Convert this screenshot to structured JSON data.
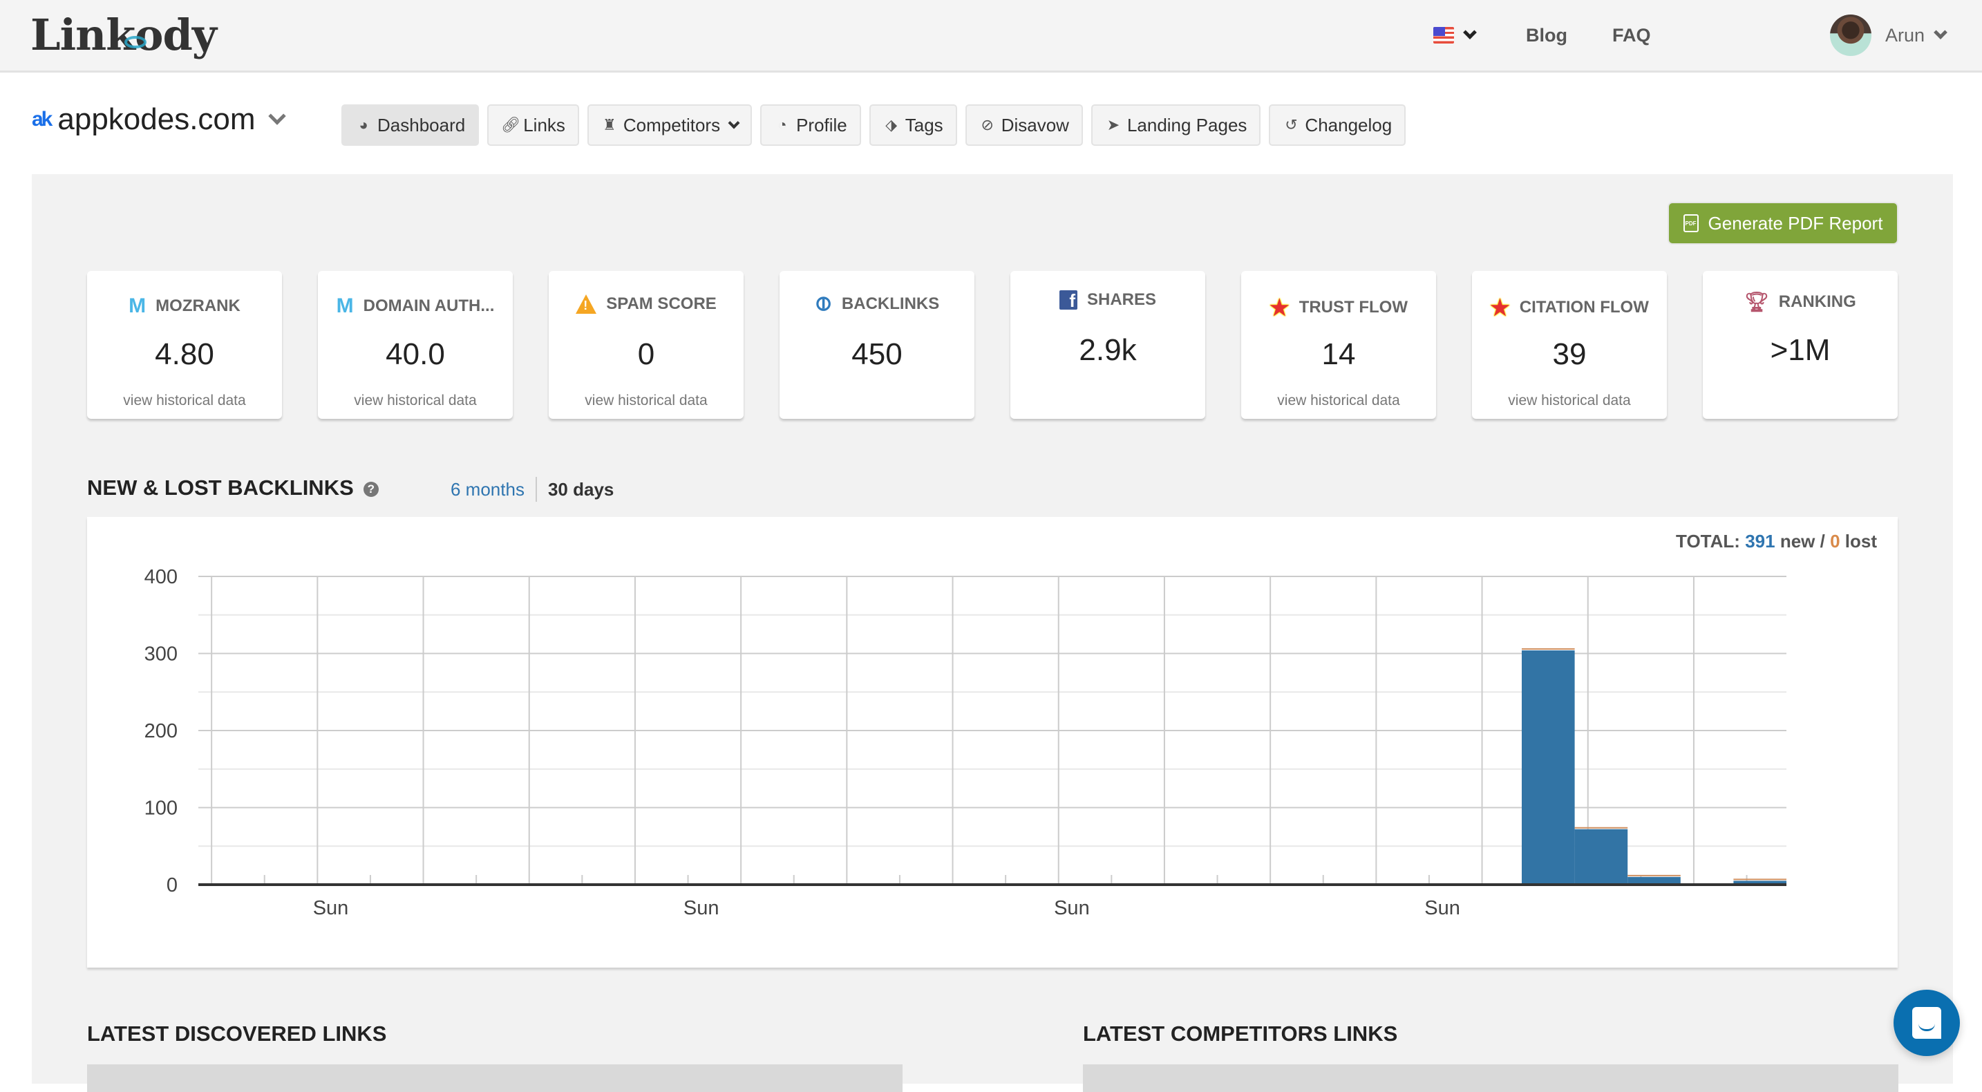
{
  "header": {
    "logo": "Linkody",
    "language_icon": "us-flag-icon",
    "links": [
      "Blog",
      "FAQ"
    ],
    "user_name": "Arun"
  },
  "site": {
    "domain": "appkodes.com",
    "domain_logo": "ak"
  },
  "nav": [
    {
      "label": "Dashboard",
      "icon": "dashboard-icon",
      "active": true
    },
    {
      "label": "Links",
      "icon": "link-icon"
    },
    {
      "label": "Competitors",
      "icon": "rook-icon",
      "dropdown": true
    },
    {
      "label": "Profile",
      "icon": "pie-chart-icon"
    },
    {
      "label": "Tags",
      "icon": "tag-icon"
    },
    {
      "label": "Disavow",
      "icon": "ban-icon"
    },
    {
      "label": "Landing Pages",
      "icon": "paper-plane-icon"
    },
    {
      "label": "Changelog",
      "icon": "history-icon"
    }
  ],
  "pdf_button": "Generate PDF Report",
  "metrics": [
    {
      "label": "MOZRANK",
      "value": "4.80",
      "footer": "view historical data",
      "icon": "moz-icon"
    },
    {
      "label": "DOMAIN AUTH...",
      "value": "40.0",
      "footer": "view historical data",
      "icon": "moz-icon"
    },
    {
      "label": "SPAM SCORE",
      "value": "0",
      "footer": "view historical data",
      "icon": "warning-icon"
    },
    {
      "label": "BACKLINKS",
      "value": "450",
      "footer": "",
      "icon": "link-icon"
    },
    {
      "label": "SHARES",
      "value": "2.9k",
      "footer": "",
      "icon": "facebook-icon"
    },
    {
      "label": "TRUST FLOW",
      "value": "14",
      "footer": "view historical data",
      "icon": "star-icon"
    },
    {
      "label": "CITATION FLOW",
      "value": "39",
      "footer": "view historical data",
      "icon": "star-icon"
    },
    {
      "label": "RANKING",
      "value": ">1M",
      "footer": "",
      "icon": "trophy-icon"
    }
  ],
  "backlinks_section": {
    "title": "NEW & LOST BACKLINKS",
    "range_options": [
      "6 months",
      "30 days"
    ],
    "selected_range": "30 days",
    "total_label": "TOTAL:",
    "total_new": "391",
    "new_label": "new /",
    "total_lost": "0",
    "lost_label": "lost"
  },
  "chart_data": {
    "type": "bar",
    "title": "NEW & LOST BACKLINKS",
    "xlabel": "",
    "ylabel": "",
    "ylim": [
      0,
      400
    ],
    "yticks": [
      0,
      100,
      200,
      300,
      400
    ],
    "grid": true,
    "days": 30,
    "x_labels": [
      {
        "day": 2.5,
        "label": "Sun"
      },
      {
        "day": 9.5,
        "label": "Sun"
      },
      {
        "day": 16.5,
        "label": "Sun"
      },
      {
        "day": 23.5,
        "label": "Sun"
      }
    ],
    "series": [
      {
        "name": "new",
        "color": "#3274a5",
        "values": [
          0,
          0,
          0,
          0,
          0,
          0,
          0,
          0,
          0,
          0,
          0,
          0,
          0,
          0,
          0,
          0,
          0,
          0,
          0,
          0,
          0,
          0,
          0,
          0,
          0,
          304,
          72,
          10,
          0,
          5
        ]
      },
      {
        "name": "lost",
        "color": "#d09060",
        "values": [
          0,
          0,
          0,
          0,
          0,
          0,
          0,
          0,
          0,
          0,
          0,
          0,
          0,
          0,
          0,
          0,
          0,
          0,
          0,
          0,
          0,
          0,
          0,
          0,
          0,
          0,
          0,
          0,
          0,
          0
        ]
      }
    ]
  },
  "lists": {
    "discovered_title": "LATEST DISCOVERED LINKS",
    "competitors_title": "LATEST COMPETITORS LINKS"
  },
  "chat_icon": "chat-icon"
}
